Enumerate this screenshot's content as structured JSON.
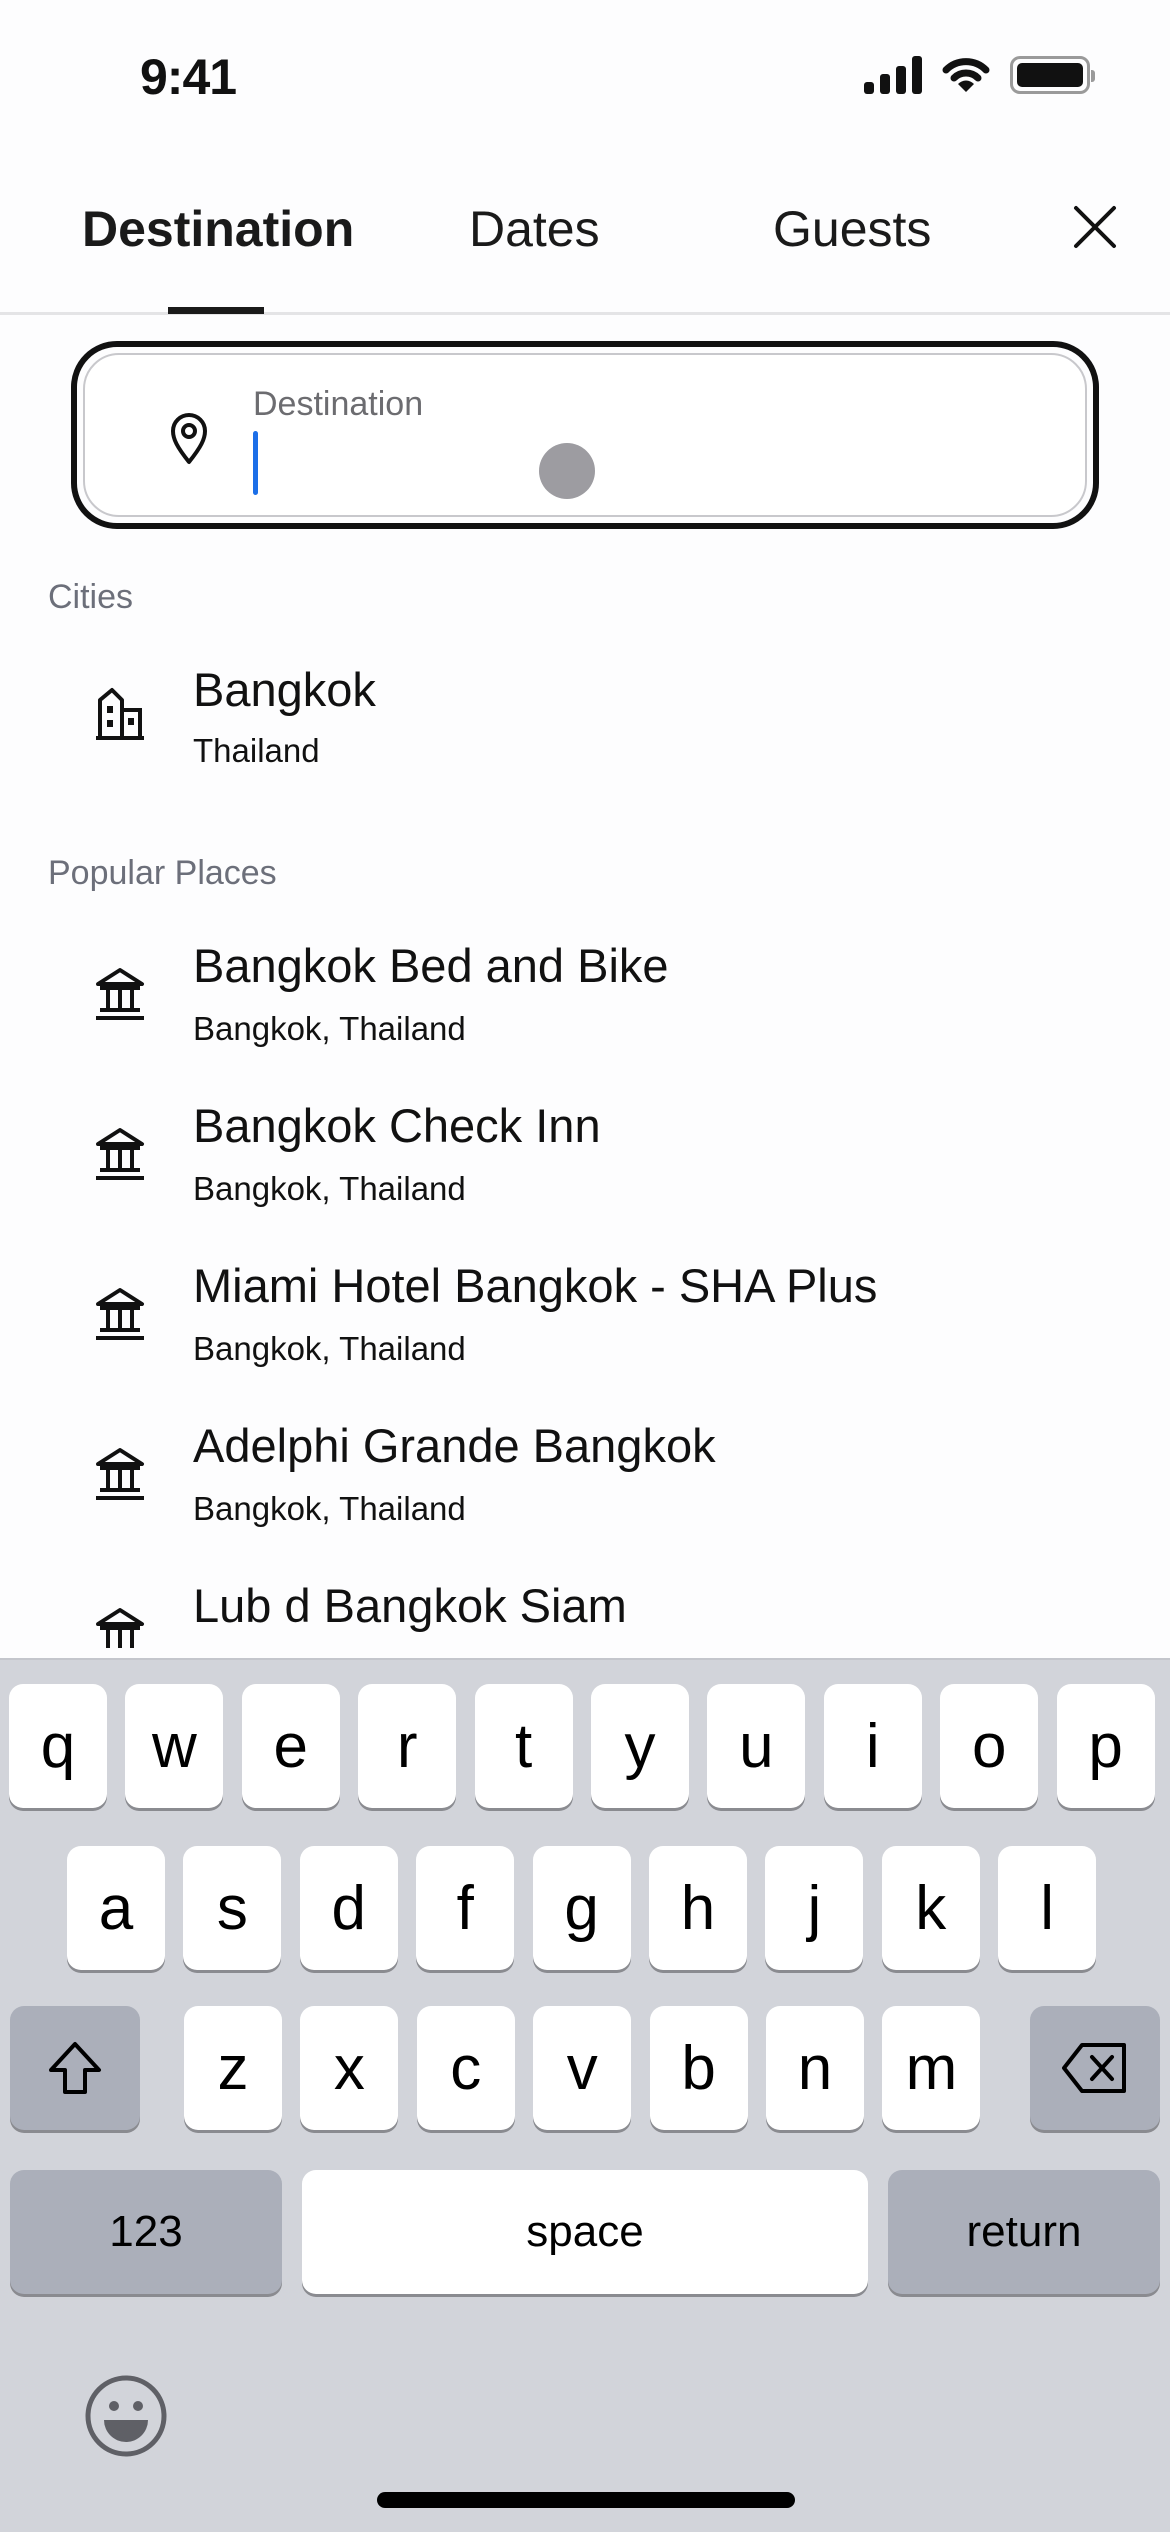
{
  "status_bar": {
    "time": "9:41",
    "icons": [
      "cellular-signal-icon",
      "wifi-icon",
      "battery-icon"
    ]
  },
  "tabs": [
    {
      "label": "Destination",
      "active": true
    },
    {
      "label": "Dates",
      "active": false
    },
    {
      "label": "Guests",
      "active": false
    }
  ],
  "close_icon": "close-icon",
  "search": {
    "label": "Destination",
    "value": "",
    "icon": "location-pin-icon",
    "accent_color": "#1c6fe8"
  },
  "cities": {
    "header": "Cities",
    "items": [
      {
        "title": "Bangkok",
        "subtitle": "Thailand",
        "icon": "city-buildings-icon"
      }
    ]
  },
  "popular_places": {
    "header": "Popular Places",
    "items": [
      {
        "title": "Bangkok Bed and Bike",
        "subtitle": "Bangkok, Thailand",
        "icon": "landmark-icon"
      },
      {
        "title": "Bangkok Check Inn",
        "subtitle": "Bangkok, Thailand",
        "icon": "landmark-icon"
      },
      {
        "title": "Miami Hotel Bangkok - SHA Plus",
        "subtitle": "Bangkok, Thailand",
        "icon": "landmark-icon"
      },
      {
        "title": "Adelphi Grande Bangkok",
        "subtitle": "Bangkok, Thailand",
        "icon": "landmark-icon"
      },
      {
        "title": "Lub d Bangkok Siam",
        "subtitle": "",
        "icon": "landmark-icon"
      }
    ]
  },
  "keyboard": {
    "row1": [
      "q",
      "w",
      "e",
      "r",
      "t",
      "y",
      "u",
      "i",
      "o",
      "p"
    ],
    "row2": [
      "a",
      "s",
      "d",
      "f",
      "g",
      "h",
      "j",
      "k",
      "l"
    ],
    "row3": [
      "z",
      "x",
      "c",
      "v",
      "b",
      "n",
      "m"
    ],
    "numbers_label": "123",
    "space_label": "space",
    "return_label": "return",
    "shift_icon": "shift-icon",
    "delete_icon": "delete-backspace-icon",
    "emoji_icon": "emoji-smiley-icon"
  }
}
